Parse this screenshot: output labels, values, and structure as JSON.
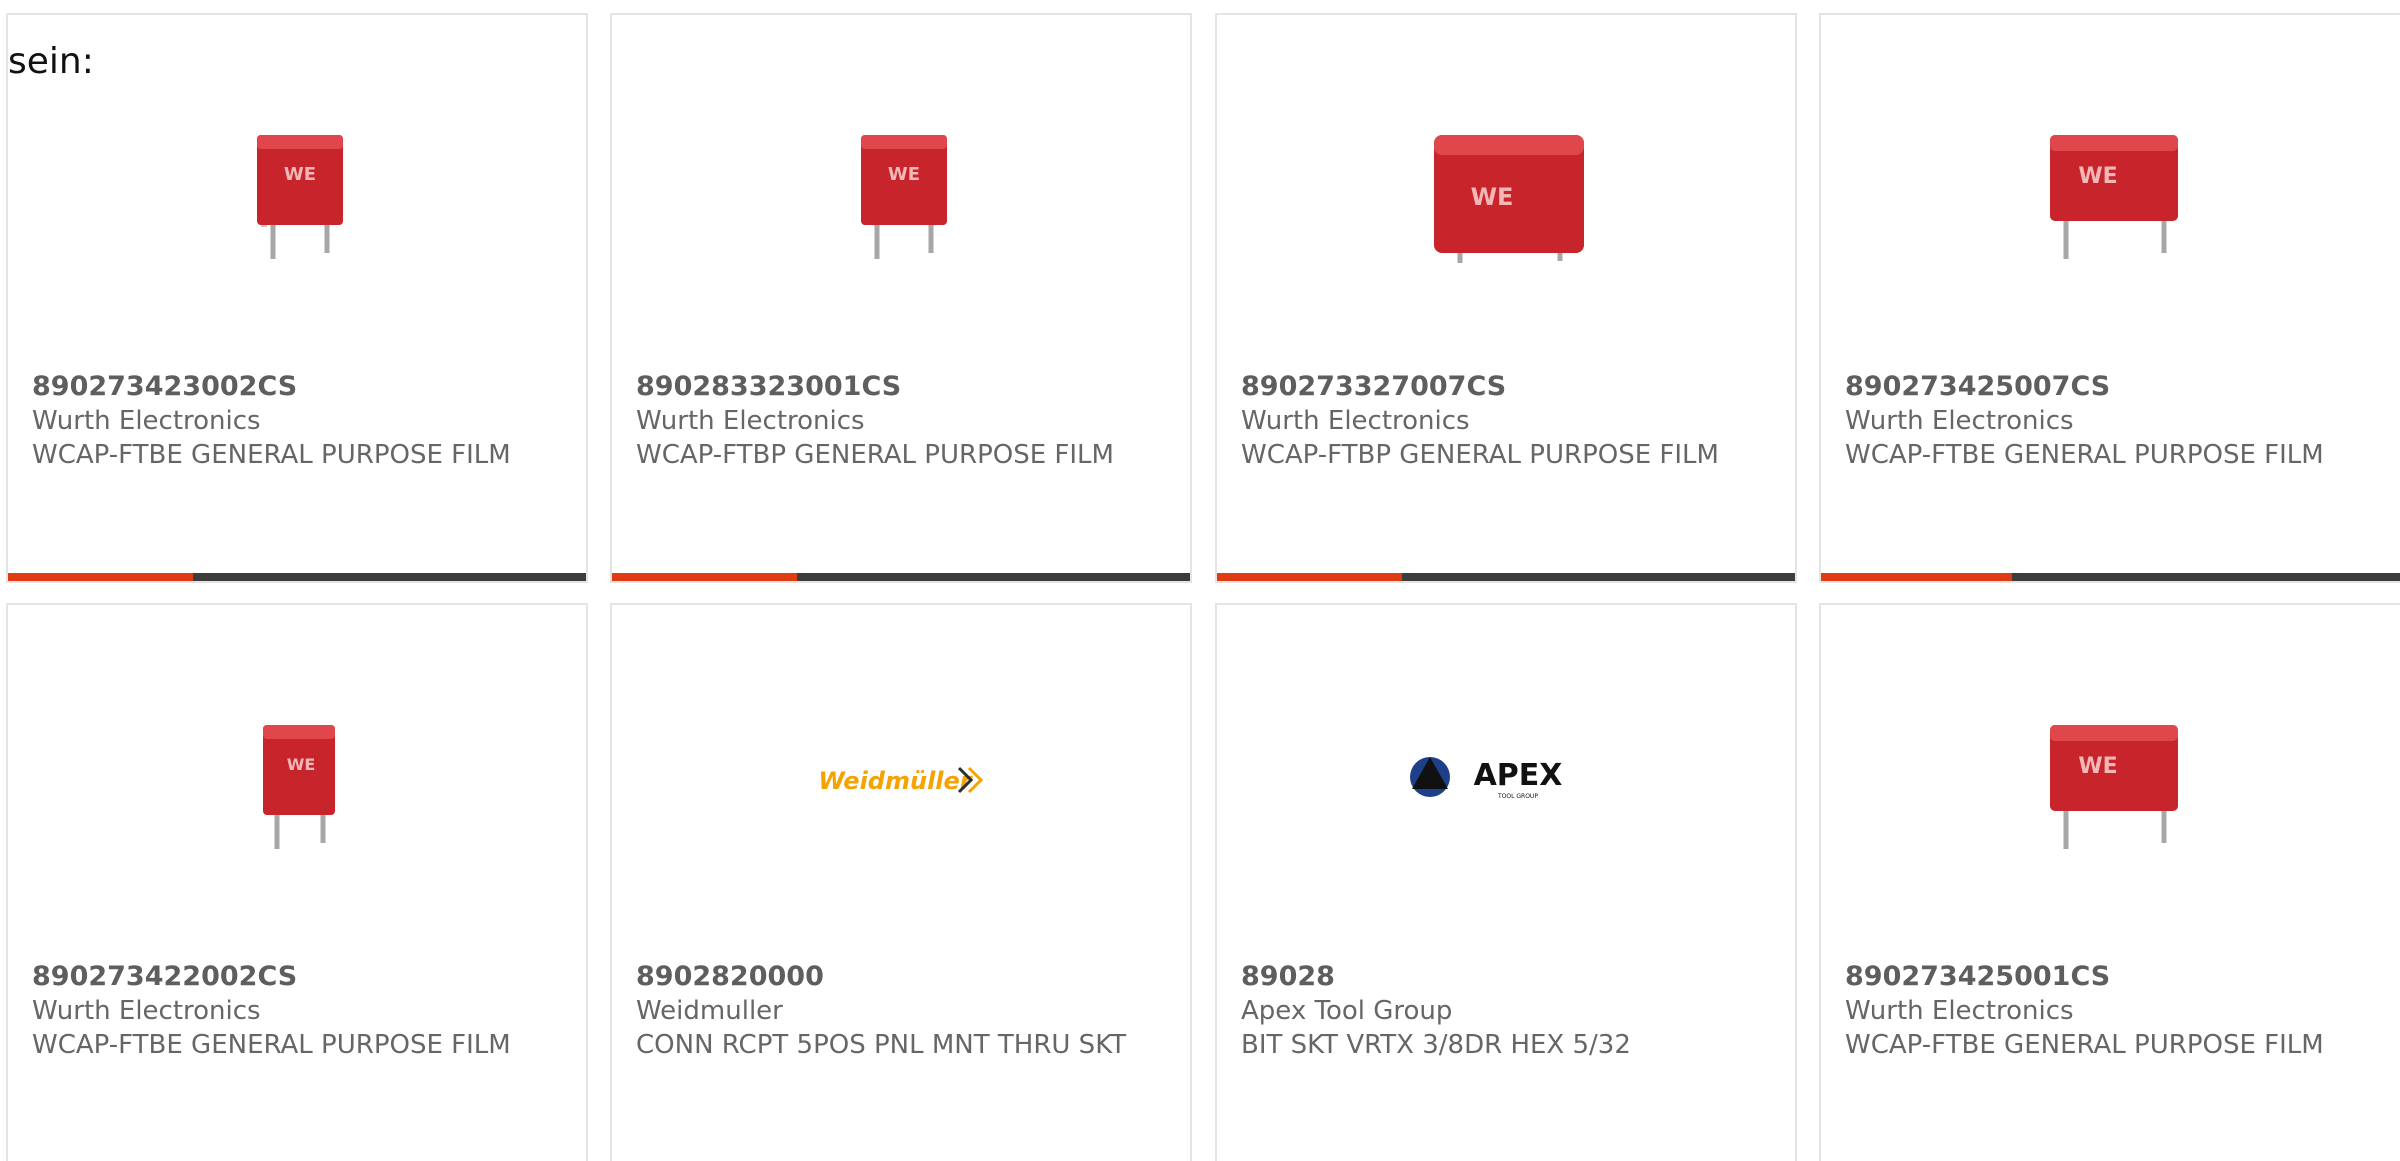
{
  "intro_text": "sein:",
  "colors": {
    "accent": "#e03b13",
    "bar": "#3d3d3d"
  },
  "cards": [
    {
      "pn": "890273423002CS",
      "mfr": "Wurth Electronics",
      "desc": "WCAP-FTBE GENERAL PURPOSE FILM",
      "image": "capacitor-small-icon",
      "progress": 0.32
    },
    {
      "pn": "890283323001CS",
      "mfr": "Wurth Electronics",
      "desc": "WCAP-FTBP GENERAL PURPOSE FILM",
      "image": "capacitor-small-icon",
      "progress": 0.32
    },
    {
      "pn": "890273327007CS",
      "mfr": "Wurth Electronics",
      "desc": "WCAP-FTBP GENERAL PURPOSE FILM",
      "image": "capacitor-large-icon",
      "progress": 0.32
    },
    {
      "pn": "890273425007CS",
      "mfr": "Wurth Electronics",
      "desc": "WCAP-FTBE GENERAL PURPOSE FILM",
      "image": "capacitor-wide-icon",
      "progress": 0.32
    },
    {
      "pn": "890273422002CS",
      "mfr": "Wurth Electronics",
      "desc": "WCAP-FTBE GENERAL PURPOSE FILM",
      "image": "capacitor-small-icon"
    },
    {
      "pn": "8902820000",
      "mfr": "Weidmuller",
      "desc": "CONN RCPT 5POS PNL MNT THRU SKT",
      "image": "weidmuller-logo",
      "logo_text": "Weidmüller"
    },
    {
      "pn": "89028",
      "mfr": "Apex Tool Group",
      "desc": "BIT SKT VRTX 3/8DR HEX 5/32",
      "image": "apex-logo",
      "logo_text": "APEX",
      "logo_sub": "TOOL GROUP"
    },
    {
      "pn": "890273425001CS",
      "mfr": "Wurth Electronics",
      "desc": "WCAP-FTBE GENERAL PURPOSE FILM",
      "image": "capacitor-wide-icon"
    }
  ]
}
